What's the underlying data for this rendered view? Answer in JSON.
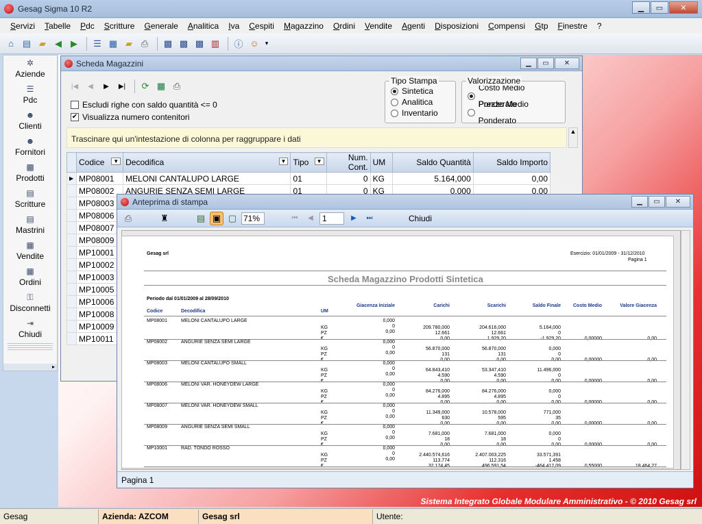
{
  "app": {
    "title": "Gesag Sigma 10 R2"
  },
  "menu": [
    "Servizi",
    "Tabelle",
    "Pdc",
    "Scritture",
    "Generale",
    "Analitica",
    "Iva",
    "Cespiti",
    "Magazzino",
    "Ordini",
    "Vendite",
    "Agenti",
    "Disposizioni",
    "Compensi",
    "Gtp",
    "Finestre",
    "?"
  ],
  "sidebar": [
    {
      "label": "Aziende",
      "icon": "settings-icon"
    },
    {
      "label": "Pdc",
      "icon": "tree-icon"
    },
    {
      "label": "Clienti",
      "icon": "people-icon"
    },
    {
      "label": "Fornitori",
      "icon": "people-icon"
    },
    {
      "label": "Prodotti",
      "icon": "cubes-icon"
    },
    {
      "label": "Scritture",
      "icon": "document-icon"
    },
    {
      "label": "Mastrini",
      "icon": "document-icon"
    },
    {
      "label": "Vendite",
      "icon": "cart-icon"
    },
    {
      "label": "Ordini",
      "icon": "cart-icon"
    },
    {
      "label": "Disconnetti",
      "icon": "key-icon"
    },
    {
      "label": "Chiudi",
      "icon": "exit-icon"
    }
  ],
  "scheda": {
    "title": "Scheda Magazzini",
    "options": {
      "escludi": "Escludi righe con saldo quantità <= 0",
      "visualizza": "Visualizza numero contenitori"
    },
    "tipo_stampa": {
      "label": "Tipo Stampa",
      "items": [
        "Sintetica",
        "Analitica",
        "Inventario"
      ],
      "selected": "Sintetica"
    },
    "valorizzazione": {
      "label": "Valorizzazione",
      "items": [
        "Costo Medio Ponderato",
        "Prezzo Medio Ponderato"
      ],
      "selected": "Costo Medio Ponderato"
    },
    "group_hint": "Trascinare qui un'intestazione di colonna per raggruppare i dati",
    "columns": [
      "Codice",
      "Decodifica",
      "Tipo",
      "Num. Cont.",
      "UM",
      "Saldo Quantità",
      "Saldo Importo"
    ],
    "rows": [
      {
        "codice": "MP08001",
        "decodifica": "MELONI CANTALUPO LARGE",
        "tipo": "01",
        "cont": "0",
        "um": "KG",
        "qta": "5.164,000",
        "importo": "0,00"
      },
      {
        "codice": "MP08002",
        "decodifica": "ANGURIE SENZA SEMI LARGE",
        "tipo": "01",
        "cont": "0",
        "um": "KG",
        "qta": "0,000",
        "importo": "0,00"
      },
      {
        "codice": "MP08003"
      },
      {
        "codice": "MP08006"
      },
      {
        "codice": "MP08007"
      },
      {
        "codice": "MP08009"
      },
      {
        "codice": "MP10001"
      },
      {
        "codice": "MP10002"
      },
      {
        "codice": "MP10003"
      },
      {
        "codice": "MP10005"
      },
      {
        "codice": "MP10006"
      },
      {
        "codice": "MP10008"
      },
      {
        "codice": "MP10009"
      },
      {
        "codice": "MP10011"
      }
    ]
  },
  "preview": {
    "title": "Anteprima di stampa",
    "zoom": "71%",
    "page": "1",
    "close_label": "Chiudi",
    "status": "Pagina 1",
    "report": {
      "company": "Gesag srl",
      "esercizio": "Esercizio: 01/01/2009 - 31/12/2010",
      "pagina": "Pagina 1",
      "title": "Scheda Magazzino Prodotti Sintetica",
      "periodo": "Periodo dal 01/01/2009 al 28/09/2010",
      "headers": [
        "Codice",
        "Decodifica",
        "UM",
        "Giacenza Iniziale",
        "Carichi",
        "Scarichi",
        "Saldo Finale",
        "Costo Medio",
        "Valore Giacenza"
      ],
      "items": [
        {
          "codice": "MP08001",
          "desc": "MELONI CANTALUPO LARGE",
          "lines": [
            [
              "KG",
              "0,000",
              "209.780,000",
              "204.616,000",
              "5.164,000"
            ],
            [
              "PZ",
              "0",
              "12.661",
              "12.661",
              "0"
            ],
            [
              "€",
              "0,00",
              "0,00",
              "1.929,20",
              "-1.929,20"
            ]
          ],
          "costo": "0,00000",
          "valore": "0,00"
        },
        {
          "codice": "MP08002",
          "desc": "ANGURIE SENZA SEMI LARGE",
          "lines": [
            [
              "KG",
              "0,000",
              "56.870,000",
              "56.870,000",
              "0,000"
            ],
            [
              "PZ",
              "0",
              "131",
              "131",
              "0"
            ],
            [
              "€",
              "0,00",
              "0,00",
              "0,00",
              "0,00"
            ]
          ],
          "costo": "0,00000",
          "valore": "0,00"
        },
        {
          "codice": "MP08003",
          "desc": "MELONI CANTALUPO SMALL",
          "lines": [
            [
              "KG",
              "0,000",
              "64.843,410",
              "53.347,410",
              "11.496,000"
            ],
            [
              "PZ",
              "0",
              "4.590",
              "4.590",
              "0"
            ],
            [
              "€",
              "0,00",
              "0,00",
              "0,00",
              "0,00"
            ]
          ],
          "costo": "0,00000",
          "valore": "0,00"
        },
        {
          "codice": "MP08006",
          "desc": "MELONI VAR. HONEYDEW LARGE",
          "lines": [
            [
              "KG",
              "0,000",
              "84.276,000",
              "84.276,000",
              "0,000"
            ],
            [
              "PZ",
              "0",
              "4.895",
              "4.895",
              "0"
            ],
            [
              "€",
              "0,00",
              "0,00",
              "0,00",
              "0,00"
            ]
          ],
          "costo": "0,00000",
          "valore": "0,00"
        },
        {
          "codice": "MP08007",
          "desc": "MELONI VAR. HONEYDEW SMALL",
          "lines": [
            [
              "KG",
              "0,000",
              "11.349,000",
              "10.578,000",
              "771,000"
            ],
            [
              "PZ",
              "0",
              "630",
              "595",
              "35"
            ],
            [
              "€",
              "0,00",
              "0,00",
              "0,00",
              "0,00"
            ]
          ],
          "costo": "0,00000",
          "valore": "0,00"
        },
        {
          "codice": "MP08009",
          "desc": "ANGURIE SENZA SEMI SMALL",
          "lines": [
            [
              "KG",
              "0,000",
              "7.681,000",
              "7.681,000",
              "0,000"
            ],
            [
              "PZ",
              "0",
              "18",
              "18",
              "0"
            ],
            [
              "€",
              "0,00",
              "0,00",
              "0,00",
              "0,00"
            ]
          ],
          "costo": "0,00000",
          "valore": "0,00"
        },
        {
          "codice": "MP10001",
          "desc": "RAD. TONDO ROSSO",
          "lines": [
            [
              "KG",
              "0,000",
              "2.440.574,616",
              "2.407.003,225",
              "33.571,391"
            ],
            [
              "PZ",
              "0",
              "113.774",
              "112.316",
              "1.458"
            ],
            [
              "€",
              "0,00",
              "32.174,45",
              "496.591,54",
              "-464.417,09"
            ]
          ],
          "costo": "0,55000",
          "valore": "18.464,27"
        }
      ]
    }
  },
  "footer": "Sistema Integrato Globale Modulare Amministrativo - © 2010 Gesag srl",
  "status": {
    "app": "Gesag",
    "azienda": "Azienda: AZCOM",
    "company": "Gesag srl",
    "utente": "Utente:"
  },
  "colors": {
    "accent": "#d01010",
    "titlebar": "#aec4e0"
  }
}
